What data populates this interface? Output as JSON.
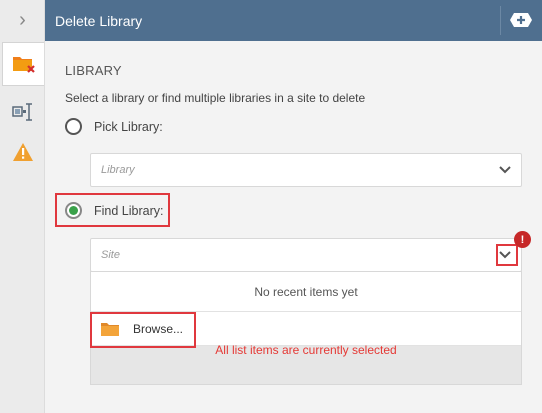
{
  "header": {
    "title": "Delete Library"
  },
  "rail": {
    "collapse_glyph": "›",
    "icons": [
      "delete-library-icon",
      "properties-icon",
      "warning-icon"
    ]
  },
  "content": {
    "section_title": "LIBRARY",
    "description": "Select a library or find multiple libraries in a site to delete",
    "pick_library_label": "Pick Library:",
    "library_placeholder": "Library",
    "find_library_label": "Find Library:",
    "site_placeholder": "Site",
    "error_badge": "!"
  },
  "dropdown": {
    "empty_text": "No recent items yet",
    "browse_label": "Browse...",
    "message": "All list items are currently selected"
  },
  "colors": {
    "header_bg": "#4f6f8f",
    "accent_green": "#3aa14a",
    "error_red": "#e53935",
    "highlight": "#e0383e",
    "folder_orange": "#f39c12"
  }
}
